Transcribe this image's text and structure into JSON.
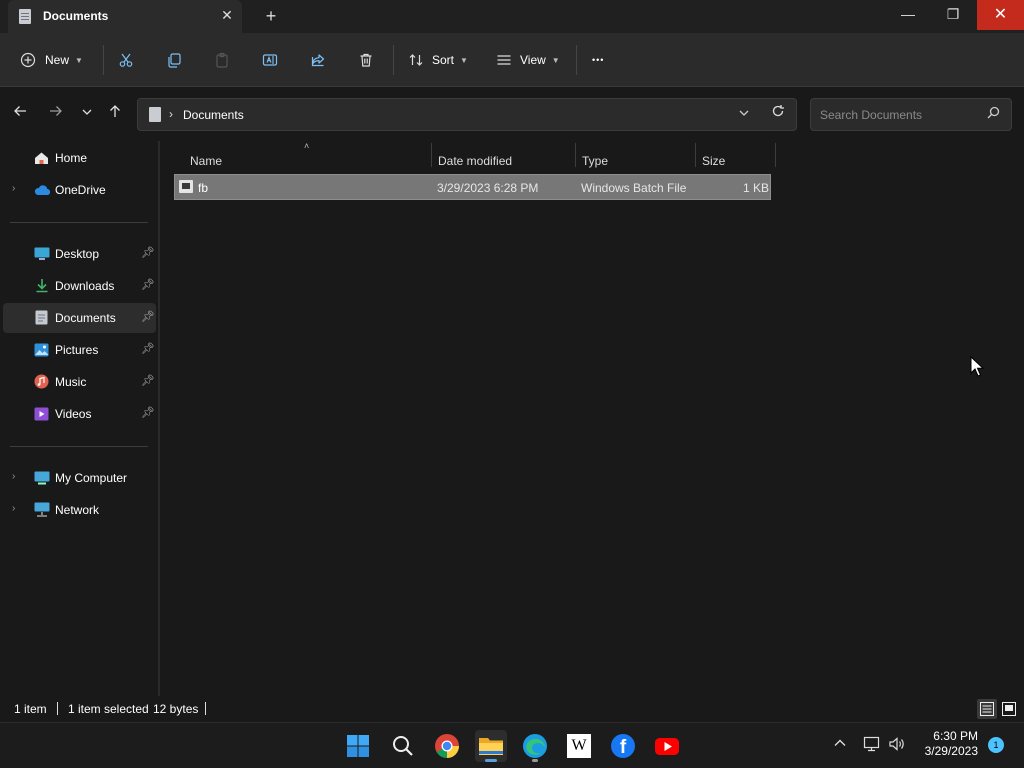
{
  "window": {
    "tab_title": "Documents",
    "tab_close": "✕",
    "new_tab": "+",
    "minimize": "—",
    "maximize": "❐",
    "close": "✕"
  },
  "toolbar": {
    "new_label": "New",
    "sort_label": "Sort",
    "view_label": "View",
    "more": "•••"
  },
  "address": {
    "breadcrumb": "Documents",
    "search_placeholder": "Search Documents"
  },
  "sidebar": {
    "quick": [
      {
        "label": "Home",
        "color": "#e0e0e0"
      },
      {
        "label": "OneDrive",
        "color": "#2b8ae0"
      }
    ],
    "pinned": [
      {
        "label": "Desktop",
        "color": "#3ba5d6"
      },
      {
        "label": "Downloads",
        "color": "#3fb36a"
      },
      {
        "label": "Documents",
        "color": "#c5cad1"
      },
      {
        "label": "Pictures",
        "color": "#2f8fd8"
      },
      {
        "label": "Music",
        "color": "#e0624f"
      },
      {
        "label": "Videos",
        "color": "#8e4fd6"
      }
    ],
    "devices": [
      {
        "label": "My Computer",
        "color": "#46a7d8"
      },
      {
        "label": "Network",
        "color": "#46a7d8"
      }
    ],
    "active": "Documents"
  },
  "columns": {
    "name": "Name",
    "date": "Date modified",
    "type": "Type",
    "size": "Size"
  },
  "files": [
    {
      "name": "fb",
      "date": "3/29/2023 6:28 PM",
      "type": "Windows Batch File",
      "size": "1 KB",
      "selected": true
    }
  ],
  "status": {
    "count": "1 item",
    "selected": "1 item selected",
    "bytes": "12 bytes"
  },
  "taskbar": {
    "apps": [
      "start-icon",
      "search-icon",
      "chrome-icon",
      "file-explorer-icon",
      "edge-icon",
      "wikipedia-icon",
      "facebook-icon",
      "youtube-icon"
    ],
    "time": "6:30 PM",
    "date": "3/29/2023",
    "notification_count": "1",
    "wiki_letter": "W",
    "fb_letter": "f"
  }
}
